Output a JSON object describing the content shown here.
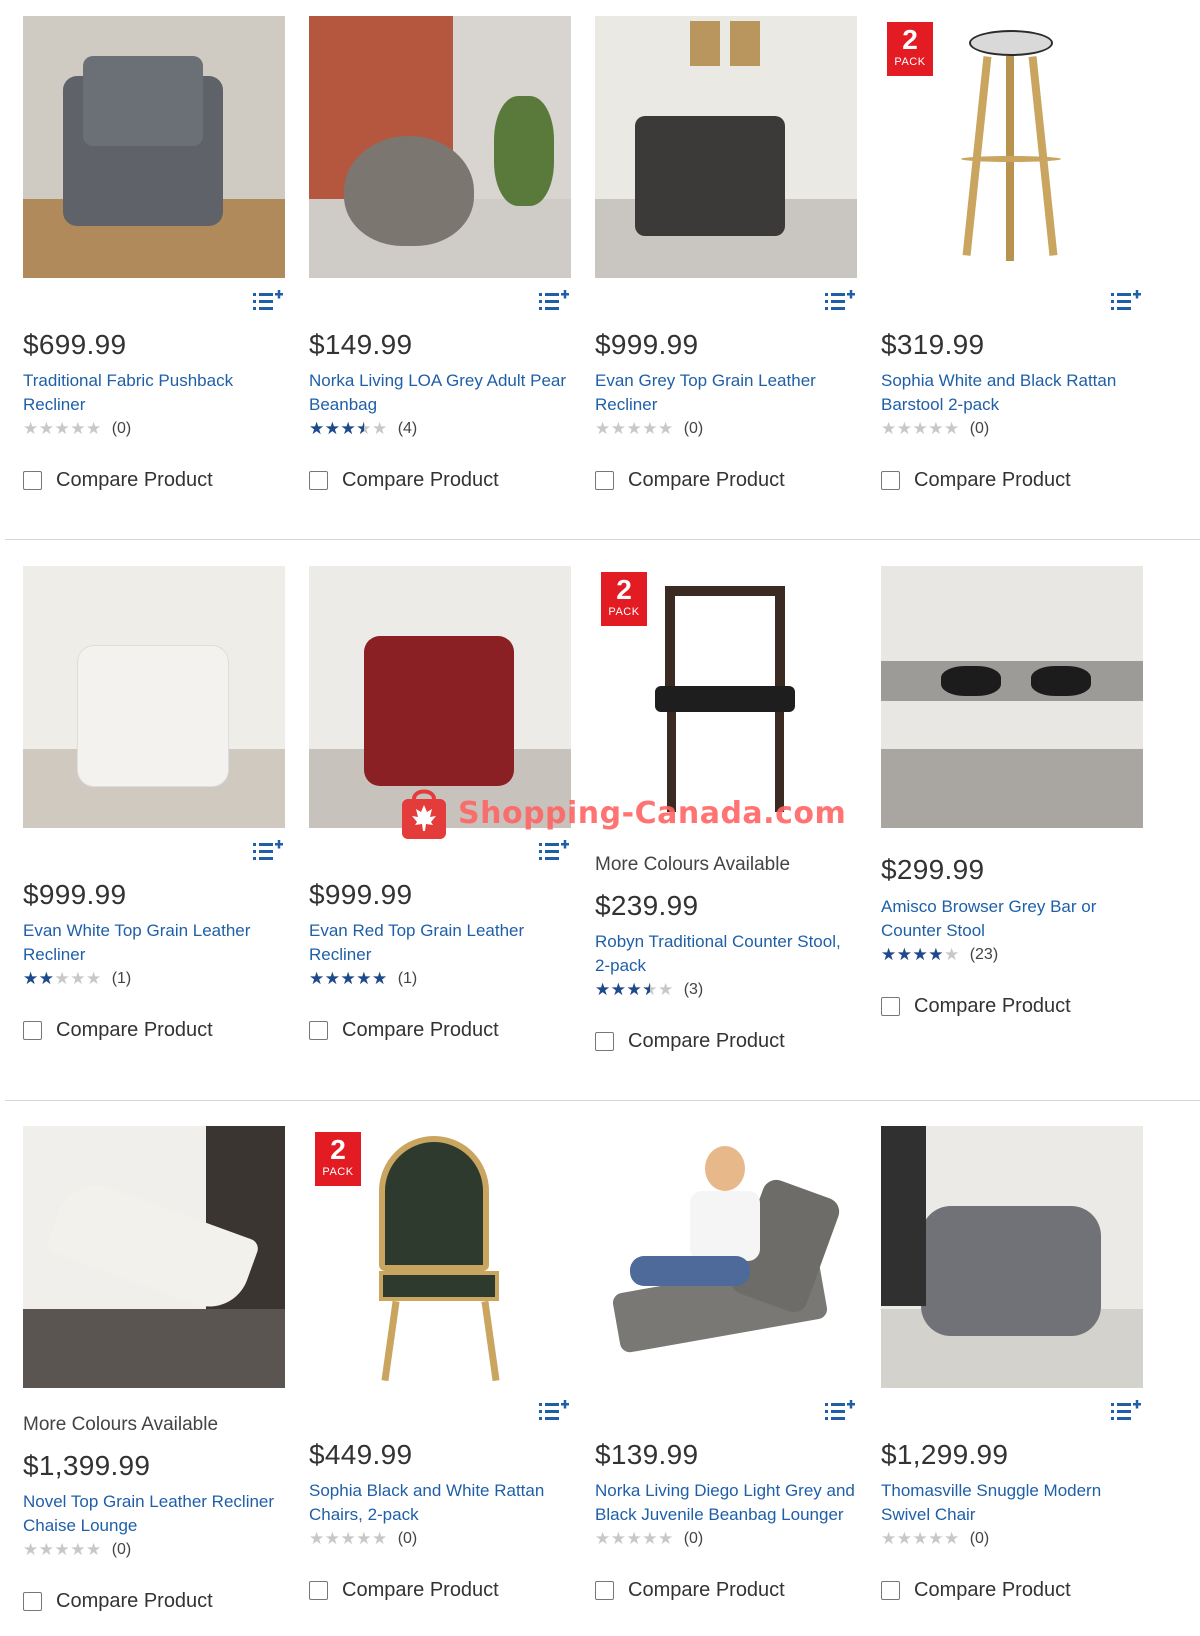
{
  "watermark": "Shopping-Canada.com",
  "compare_label": "Compare Product",
  "pack_badge": {
    "number": "2",
    "text": "PACK"
  },
  "colors": {
    "link": "#1f5fa8",
    "star": "#1e4a8c",
    "badge": "#e31c24"
  },
  "rows": [
    [
      {
        "price": "$699.99",
        "title": "Traditional Fabric Pushback Recliner",
        "rating": 0,
        "count": "(0)"
      },
      {
        "price": "$149.99",
        "title": "Norka Living LOA Grey Adult Pear Beanbag",
        "rating": 3.5,
        "count": "(4)"
      },
      {
        "price": "$999.99",
        "title": "Evan Grey Top Grain Leather Recliner",
        "rating": 0,
        "count": "(0)"
      },
      {
        "price": "$319.99",
        "title": "Sophia White and Black Rattan Barstool 2-pack",
        "rating": 0,
        "count": "(0)"
      }
    ],
    [
      {
        "price": "$999.99",
        "title": "Evan White Top Grain Leather Recliner",
        "rating": 2,
        "count": "(1)"
      },
      {
        "price": "$999.99",
        "title": "Evan Red Top Grain Leather Recliner",
        "rating": 5,
        "count": "(1)"
      },
      {
        "price": "$239.99",
        "title": "Robyn Traditional Counter Stool, 2-pack",
        "rating": 3.5,
        "count": "(3)",
        "availability": "More Colours Available"
      },
      {
        "price": "$299.99",
        "title": "Amisco Browser Grey Bar or Counter Stool",
        "rating": 4,
        "count": "(23)"
      }
    ],
    [
      {
        "price": "$1,399.99",
        "title": "Novel Top Grain Leather Recliner Chaise Lounge",
        "rating": 0,
        "count": "(0)",
        "availability": "More Colours Available"
      },
      {
        "price": "$449.99",
        "title": "Sophia Black and White Rattan Chairs, 2-pack",
        "rating": 0,
        "count": "(0)"
      },
      {
        "price": "$139.99",
        "title": "Norka Living Diego Light Grey and Black Juvenile Beanbag Lounger",
        "rating": 0,
        "count": "(0)"
      },
      {
        "price": "$1,299.99",
        "title": "Thomasville Snuggle Modern Swivel Chair",
        "rating": 0,
        "count": "(0)"
      }
    ]
  ]
}
